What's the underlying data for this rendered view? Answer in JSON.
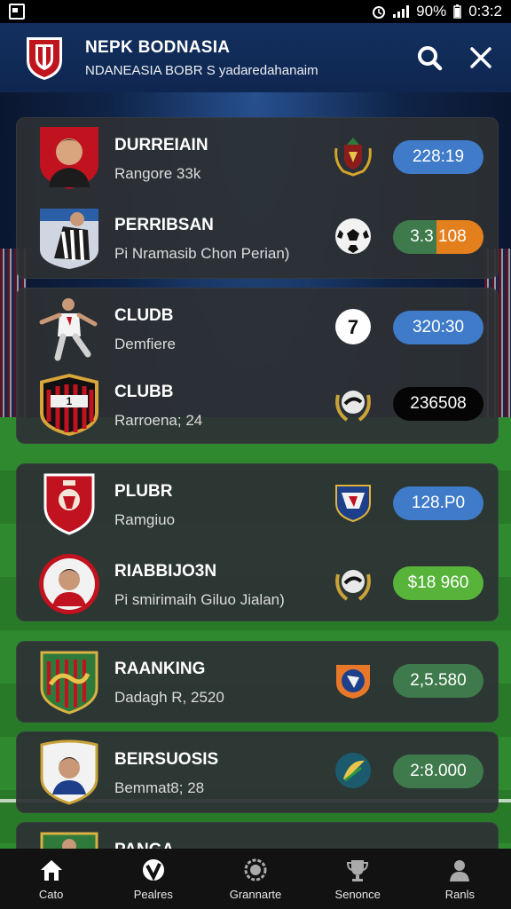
{
  "status_bar": {
    "battery": "90%",
    "time": "0:3:2"
  },
  "header": {
    "title": "NEPK BODNASIA",
    "subtitle": "NDANEASIA BOBR S yadaredahanaim",
    "search_icon": "search-icon",
    "close_icon": "close-icon"
  },
  "cards": [
    {
      "rows": [
        {
          "name": "DURREIAIN",
          "sub": "Rangore 33k",
          "value": "228:19",
          "pill": "blue",
          "logo": "red-shield-player-portrait",
          "badge": "gold-crest-badge"
        },
        {
          "name": "PERRIBSAN",
          "sub": "Pi Nramasib Chon Perian)",
          "value": "3.3 108",
          "pill": "split",
          "logo": "player-action-photo",
          "badge": "soccer-ball-icon"
        }
      ]
    },
    {
      "rows": [
        {
          "name": "CLUDB",
          "sub": "Demfiere",
          "value": "320:30",
          "pill": "blue",
          "logo": "player-kick-photo",
          "badge": "number-7-badge",
          "badge_text": "7"
        },
        {
          "name": "CLUBB",
          "sub": "Rarroena; 24",
          "value": "236508",
          "pill": "black",
          "logo": "striped-club-crest",
          "badge": "laurel-ball-badge"
        }
      ]
    },
    {
      "rows": [
        {
          "name": "PLUBR",
          "sub": "Ramgiuo",
          "value": "128.P0",
          "pill": "blue",
          "logo": "red-lion-crest",
          "badge": "blue-shield-badge"
        },
        {
          "name": "RIABBIJO3N",
          "sub": "Pi smirimaih Giluo Jialan)",
          "value": "$18 960",
          "pill": "lime",
          "logo": "circle-player-portrait",
          "badge": "laurel-ball-badge"
        }
      ]
    },
    {
      "rows": [
        {
          "name": "RAANKING",
          "sub": "Dadagh R, 2520",
          "value": "2,5.580",
          "pill": "green",
          "logo": "green-dragon-crest",
          "badge": "orange-blue-badge"
        }
      ]
    },
    {
      "rows": [
        {
          "name": "BEIRSUOSIS",
          "sub": "Bemmat8; 28",
          "value": "2:8.000",
          "pill": "green",
          "logo": "shield-player-portrait",
          "badge": "feather-badge"
        }
      ]
    },
    {
      "rows": [
        {
          "name": "PANGA",
          "sub": "",
          "value": "",
          "pill": "green",
          "logo": "green-club-crest",
          "badge": ""
        }
      ]
    }
  ],
  "bottom_nav": [
    {
      "label": "Cato",
      "icon": "home-icon"
    },
    {
      "label": "Pealres",
      "icon": "shield-v-icon"
    },
    {
      "label": "Grannarte",
      "icon": "gear-ball-icon"
    },
    {
      "label": "Senonce",
      "icon": "trophy-icon"
    },
    {
      "label": "Ranls",
      "icon": "user-icon"
    }
  ],
  "colors": {
    "header": "#12305f",
    "card": "#2d3034",
    "pill_blue": "#3f7bc8",
    "pill_green": "#3f7a4c",
    "pill_lime": "#57b33a",
    "pill_orange": "#e47f1d",
    "nav": "#121212"
  }
}
